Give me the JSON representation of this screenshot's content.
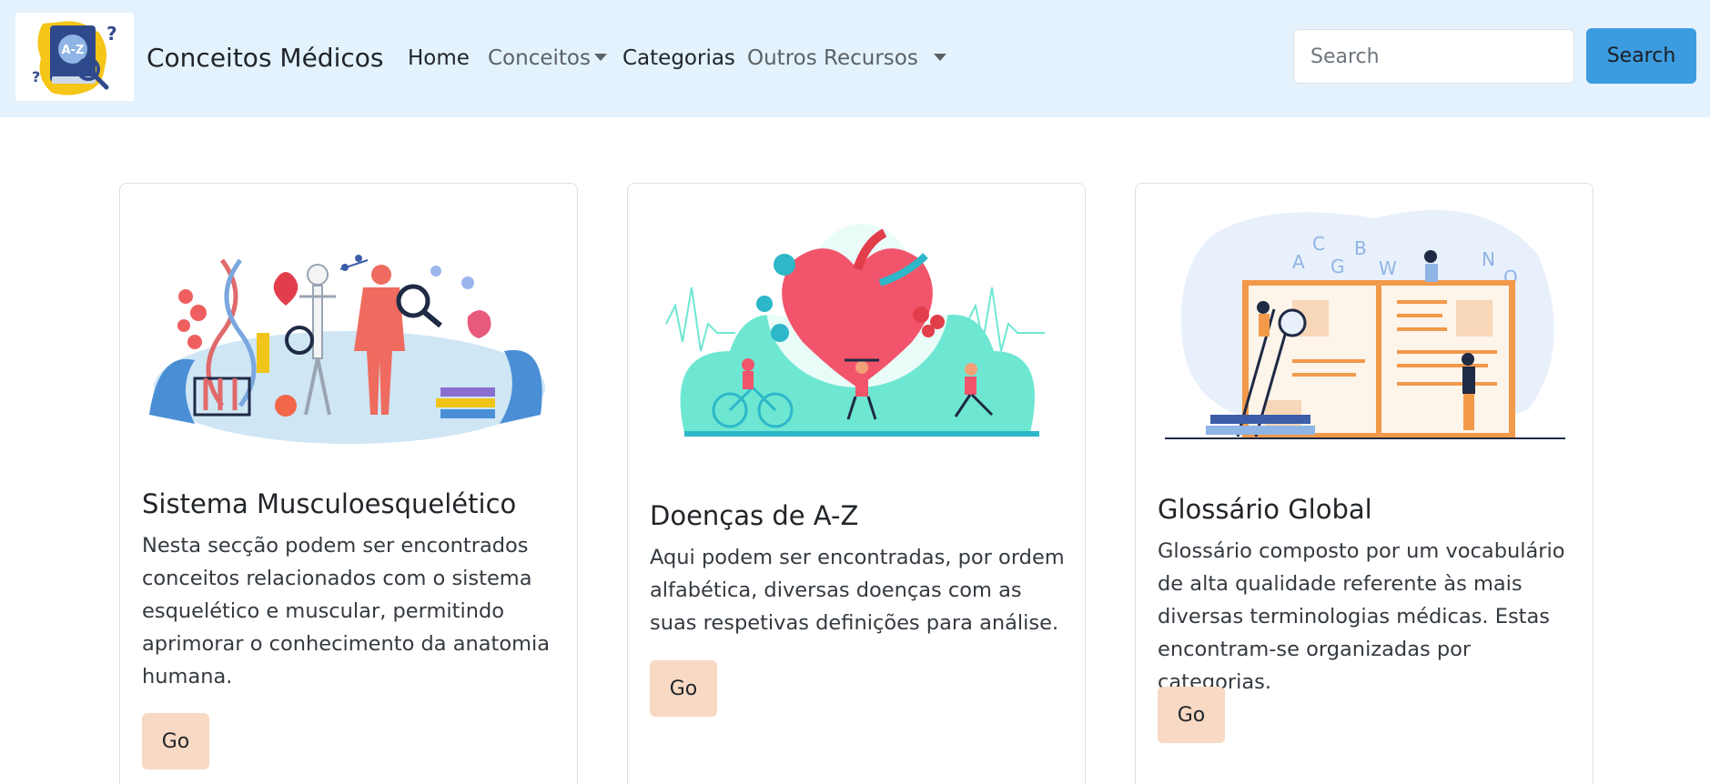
{
  "navbar": {
    "logo_text": "A-Z",
    "brand": "Conceitos Médicos",
    "links": [
      {
        "label": "Home"
      },
      {
        "label": "Conceitos"
      },
      {
        "label": "Categorias"
      },
      {
        "label": "Outros Recursos"
      }
    ],
    "search": {
      "placeholder": "Search",
      "value": ""
    },
    "search_button": "Search"
  },
  "cards": [
    {
      "title": "Sistema Musculoesquelético",
      "text": "Nesta secção podem ser encontrados conceitos relacionados com o sistema esquelético e muscular, permitindo aprimorar o conhecimento da anatomia humana.",
      "button": "Go"
    },
    {
      "title": "Doenças de A-Z",
      "text": "Aqui podem ser encontradas, por ordem alfabética, diversas doenças com as suas respetivas definições para análise.",
      "button": "Go"
    },
    {
      "title": "Glossário Global",
      "text": "Glossário composto por um vocabulário de alta qualidade referente às mais diversas terminologias médicas. Estas encontram-se organizadas por categorias.",
      "button": "Go",
      "illustration_letters": [
        "A",
        "C",
        "G",
        "B",
        "W",
        "N",
        "Q"
      ]
    }
  ],
  "colors": {
    "navbar_bg": "#e3f2fd",
    "search_button": "#3d9be0",
    "go_button": "#f8d9c4",
    "teal": "#6ee7d2",
    "heart": "#f2556b",
    "book_orange": "#f2994a"
  }
}
